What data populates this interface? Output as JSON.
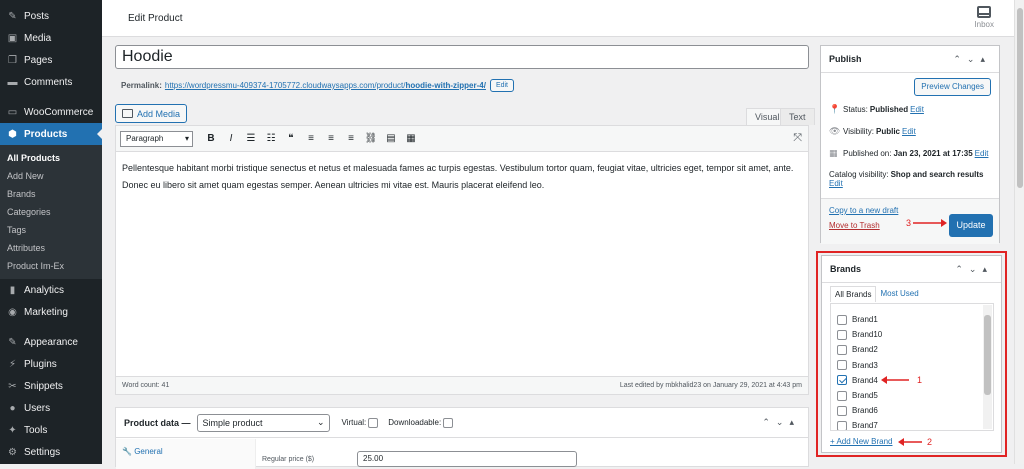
{
  "sidebar": {
    "items": [
      {
        "label": "Posts",
        "icon": "pin-icon"
      },
      {
        "label": "Media",
        "icon": "media-icon"
      },
      {
        "label": "Pages",
        "icon": "pages-icon"
      },
      {
        "label": "Comments",
        "icon": "comments-icon"
      }
    ],
    "woo": {
      "label": "WooCommerce",
      "icon": "woo-icon"
    },
    "products": {
      "label": "Products",
      "icon": "products-icon"
    },
    "subitems": [
      "All Products",
      "Add New",
      "Brands",
      "Categories",
      "Tags",
      "Attributes",
      "Product Im-Ex"
    ],
    "lower": [
      {
        "label": "Analytics",
        "icon": "analytics-icon"
      },
      {
        "label": "Marketing",
        "icon": "marketing-icon"
      }
    ],
    "bottom": [
      {
        "label": "Appearance",
        "icon": "appearance-icon"
      },
      {
        "label": "Plugins",
        "icon": "plugins-icon"
      },
      {
        "label": "Snippets",
        "icon": "snippets-icon"
      },
      {
        "label": "Users",
        "icon": "users-icon"
      },
      {
        "label": "Tools",
        "icon": "tools-icon"
      },
      {
        "label": "Settings",
        "icon": "settings-icon"
      }
    ]
  },
  "header": {
    "title": "Edit Product",
    "inbox": "Inbox"
  },
  "editor": {
    "title_value": "Hoodie",
    "permalink_label": "Permalink:",
    "permalink_url": "https://wordpressmu-409374-1705772.cloudwaysapps.com/product/",
    "permalink_slug": "hoodie-with-zipper-4/",
    "permalink_edit": "Edit",
    "add_media": "Add Media",
    "tab_visual": "Visual",
    "tab_text": "Text",
    "format": "Paragraph",
    "content": "Pellentesque habitant morbi tristique senectus et netus et malesuada fames ac turpis egestas. Vestibulum tortor quam, feugiat vitae, ultricies eget, tempor sit amet, ante. Donec eu libero sit amet quam egestas semper. Aenean ultricies mi vitae est. Mauris placerat eleifend leo.",
    "word_count": "Word count: 41",
    "last_edited": "Last edited by mbkhalid23 on January 29, 2021 at 4:43 pm"
  },
  "product_data": {
    "label": "Product data —",
    "type": "Simple product",
    "virtual": "Virtual:",
    "downloadable": "Downloadable:",
    "tab_general": "General",
    "regular_price_label": "Regular price ($)",
    "regular_price": "25.00"
  },
  "publish": {
    "title": "Publish",
    "preview": "Preview Changes",
    "status_label": "Status:",
    "status": "Published",
    "visibility_label": "Visibility:",
    "visibility": "Public",
    "published_on_label": "Published on:",
    "published_on": "Jan 23, 2021 at 17:35",
    "edit": "Edit",
    "catalog_label": "Catalog visibility:",
    "catalog": "Shop and search results",
    "copy_draft": "Copy to a new draft",
    "trash": "Move to Trash",
    "update": "Update"
  },
  "brands": {
    "title": "Brands",
    "tab_all": "All Brands",
    "tab_most_used": "Most Used",
    "items": [
      {
        "label": "Brand1",
        "checked": false
      },
      {
        "label": "Brand10",
        "checked": false
      },
      {
        "label": "Brand2",
        "checked": false
      },
      {
        "label": "Brand3",
        "checked": false
      },
      {
        "label": "Brand4",
        "checked": true
      },
      {
        "label": "Brand5",
        "checked": false
      },
      {
        "label": "Brand6",
        "checked": false
      },
      {
        "label": "Brand7",
        "checked": false
      }
    ],
    "add_new": "+ Add New Brand"
  },
  "annotations": {
    "one": "1",
    "two": "2",
    "three": "3"
  },
  "colors": {
    "accent": "#2271b1",
    "annotation": "#e02424",
    "sidebar_bg": "#1d2327"
  }
}
